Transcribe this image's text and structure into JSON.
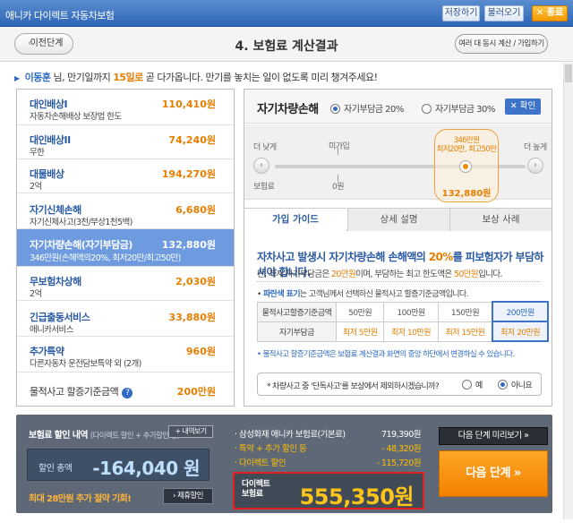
{
  "titlebar": {
    "title": "애니카 다이렉트 자동차보험",
    "save": "저장하기",
    "load": "불러오기",
    "close_icon": "✕",
    "close": "종료"
  },
  "header": {
    "prev": "이전단계",
    "title": "4. 보험료 계산결과",
    "multi": "여러 대 동시 계산 / 가입하기"
  },
  "notice": {
    "name": "이동훈",
    "pre": " 님, 만기일까지 ",
    "days": "15일로",
    "post": " 곧 다가옵니다. 만기를 놓치는 일이 없도록 미리 챙겨주세요!"
  },
  "coverages": [
    {
      "name": "대인배상I",
      "desc": "자동차손해배상 보장법 한도",
      "value": "110,410원"
    },
    {
      "name": "대인배상II",
      "desc": "무한",
      "value": "74,240원"
    },
    {
      "name": "대물배상",
      "desc": "2억",
      "value": "194,270원"
    },
    {
      "name": "자기신체손해",
      "desc": "자기신체사고(3천/부상1천5백)",
      "value": "6,680원"
    },
    {
      "name": "자기차량손해(자기부담금)",
      "desc": "346만원(손해액의20%, 최저20만/최고50만)",
      "value": "132,880원"
    },
    {
      "name": "무보험차상해",
      "desc": "2억",
      "value": "2,030원"
    },
    {
      "name": "긴급출동서비스",
      "desc": "애니카서비스",
      "value": "33,880원"
    },
    {
      "name": "추가특약",
      "desc": "다른자동차 운전담보특약 외 (2개)",
      "value": "960원"
    },
    {
      "name": "물적사고 할증기준금액",
      "desc": "",
      "value": "200만원"
    }
  ],
  "detail_panel": {
    "title": "자기차량손해",
    "option1": "자기부담금 20%",
    "option2": "자기부담금 30%",
    "confirm": "✕ 확인",
    "slider": {
      "left_label": "더 낮게",
      "right_label": "더 높게",
      "not_joined": "미가입",
      "premium_label": "보험료",
      "premium_zero": "0원",
      "bubble_amount": "346만원",
      "bubble_range": "최저20만, 최고50만",
      "bubble_price": "132,880원",
      "prev_icon": "‹",
      "next_icon": "›"
    },
    "tabs": [
      "가입 가이드",
      "상세 설명",
      "보상 사례"
    ],
    "guide": {
      "title_pre": "자차사고 발생시 자기차량손해 손해액의 ",
      "title_pct": "20%",
      "title_post": "를 피보험자가 부담하셔야 합니다.",
      "sub_pre": "단, 최저 자기부담금은 ",
      "sub_min": "20만원",
      "sub_mid": "이며, 부담하는 최고 한도액은 ",
      "sub_max": "50만원",
      "sub_post": "입니다.",
      "note_bold": "파란색 표기",
      "note_pre": "• ",
      "note_post": "는 고객님께서 선택하신 물적사고 할증기준금액입니다.",
      "table": {
        "row1_head": "물적사고할증기준금액",
        "row1": [
          "50만원",
          "100만원",
          "150만원",
          "200만원"
        ],
        "row2_head": "자기부담금",
        "row2": [
          "최저 5만원",
          "최저 10만원",
          "최저 15만원",
          "최저 20만원"
        ]
      },
      "footnote": "• 물적사고 할증기준금액은 보험료 계산결과 화면의 중앙 하단에서 변경하실 수 있습니다.",
      "question": "* 차량사고 중 '단독사고'를 보상에서 제외하시겠습니까?",
      "yes": "예",
      "no": "아니요"
    }
  },
  "discount": {
    "title": "보험료 할인 내역",
    "title_sub": "(다이렉트 할인 + 추가할인 등)",
    "detail_btn": "+ 내역보기",
    "total_label": "할인 총액",
    "total_value": "-164,040 원",
    "promo": "최대 28만원 추가 절약 기회!",
    "promo_btn": "› 제휴할인"
  },
  "summary": {
    "row1_label": "· 삼성화재 애니카 보험료(기본료)",
    "row1_value": "719,390원",
    "row2_label": "· 특약 + 추가 할인 등",
    "row2_value": "- 48,320원",
    "row3_label": "· 다이렉트 할인",
    "row3_value": "- 115,720원",
    "final_label": "다이렉트 보험료",
    "final_value": "555,350원"
  },
  "next": {
    "preview": "다음 단계 미리보기 »",
    "next": "다음 단계  »"
  },
  "colors": {
    "accent_blue": "#2d6bc4",
    "accent_orange": "#e67e00",
    "highlight_red": "#e02020"
  }
}
